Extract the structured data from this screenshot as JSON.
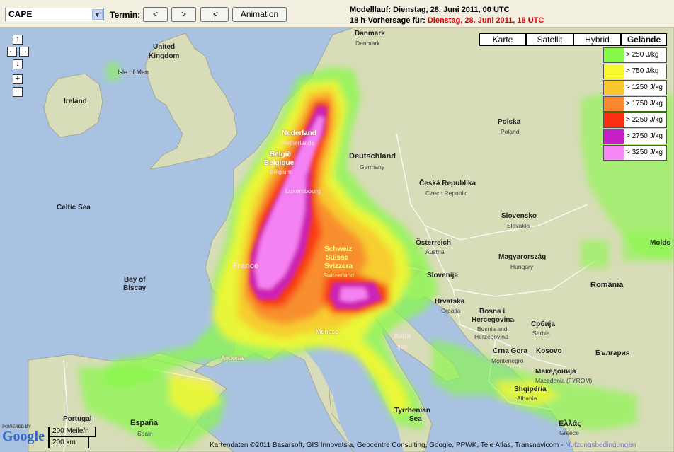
{
  "toolbar": {
    "parameter": "CAPE",
    "termin_label": "Termin:",
    "prev_label": "<",
    "next_label": ">",
    "first_label": "|<",
    "animation_label": "Animation",
    "model_run": "Modelllauf: Dienstag, 28. Juni 2011, 00 UTC",
    "forecast_prefix": "18 h-Vorhersage für:",
    "forecast_date": "Dienstag, 28. Juni 2011, 18 UTC"
  },
  "map_types": [
    "Karte",
    "Satellit",
    "Hybrid",
    "Gelände"
  ],
  "active_map_type": "Gelände",
  "legend": [
    {
      "label": "> 250 J/kg",
      "color": "#88f848"
    },
    {
      "label": "> 750 J/kg",
      "color": "#f8f830"
    },
    {
      "label": "> 1250 J/kg",
      "color": "#f8c830"
    },
    {
      "label": "> 1750 J/kg",
      "color": "#f88830"
    },
    {
      "label": "> 2250 J/kg",
      "color": "#f83010"
    },
    {
      "label": "> 2750 J/kg",
      "color": "#c820c8"
    },
    {
      "label": "> 3250 J/kg",
      "color": "#f888f8"
    }
  ],
  "nav": {
    "up": "↑",
    "left": "←",
    "right": "→",
    "down": "↓",
    "zoom_in": "+",
    "zoom_out": "−"
  },
  "places": {
    "danmark": "Danmark",
    "danmark2": "Denmark",
    "uk": "United",
    "uk2": "Kingdom",
    "isle_of_man": "Isle of Man",
    "ireland": "Ireland",
    "polska": "Polska",
    "polska2": "Poland",
    "nederland": "Nederland",
    "nederland2": "Netherlands",
    "belgie": "België",
    "belgique": "Belgique",
    "belgium": "Belgium",
    "deutschland": "Deutschland",
    "germany": "Germany",
    "celtic_sea": "Celtic Sea",
    "luxembourg": "Luxembourg",
    "cesko": "Česká Republika",
    "czech": "Czech Republic",
    "slovensko": "Slovensko",
    "slovakia": "Slovakia",
    "osterreich": "Österreich",
    "austria": "Austria",
    "magyar": "Magyarország",
    "hungary": "Hungary",
    "schweiz": "Schweiz",
    "suisse": "Suisse",
    "svizzera": "Svizzera",
    "switzerland": "Switzerland",
    "france": "France",
    "bay_of_biscay1": "Bay of",
    "bay_of_biscay2": "Biscay",
    "slovenija": "Slovenija",
    "romania": "România",
    "hrvatska": "Hrvatska",
    "croatia": "Croatia",
    "bosna1": "Bosna i",
    "bosna2": "Hercegovina",
    "bosna3": "Bosnia and",
    "bosna4": "Herzegovina",
    "srbija": "Србија",
    "serbia": "Serbia",
    "monaco": "Monaco",
    "italia": "Italia",
    "italy": "Italy",
    "crna_gora": "Crna Gora",
    "montenegro": "Montenegro",
    "kosovo": "Kosovo",
    "bulgaria": "България",
    "makedonija": "Македонија",
    "fyrom": "Macedonia (FYROM)",
    "andorra": "Andorra",
    "shqiperia": "Shqipëria",
    "albania": "Albania",
    "espana": "España",
    "spain": "Spain",
    "portugal": "Portugal",
    "tyrrhenian1": "Tyrrhenian",
    "tyrrhenian2": "Sea",
    "ellas": "Ελλάς",
    "greece": "Greece",
    "moldova": "Moldo"
  },
  "scale": {
    "top": "200 Meile/n",
    "bottom": "200 km"
  },
  "logo": {
    "powered": "POWERED BY",
    "name": "Google"
  },
  "copyright": "Kartendaten ©2011 Basarsoft, GIS Innovatsia, Geocentre Consulting, Google, PPWK, Tele Atlas, Transnavicom -",
  "terms": "Nutzungsbedingungen"
}
